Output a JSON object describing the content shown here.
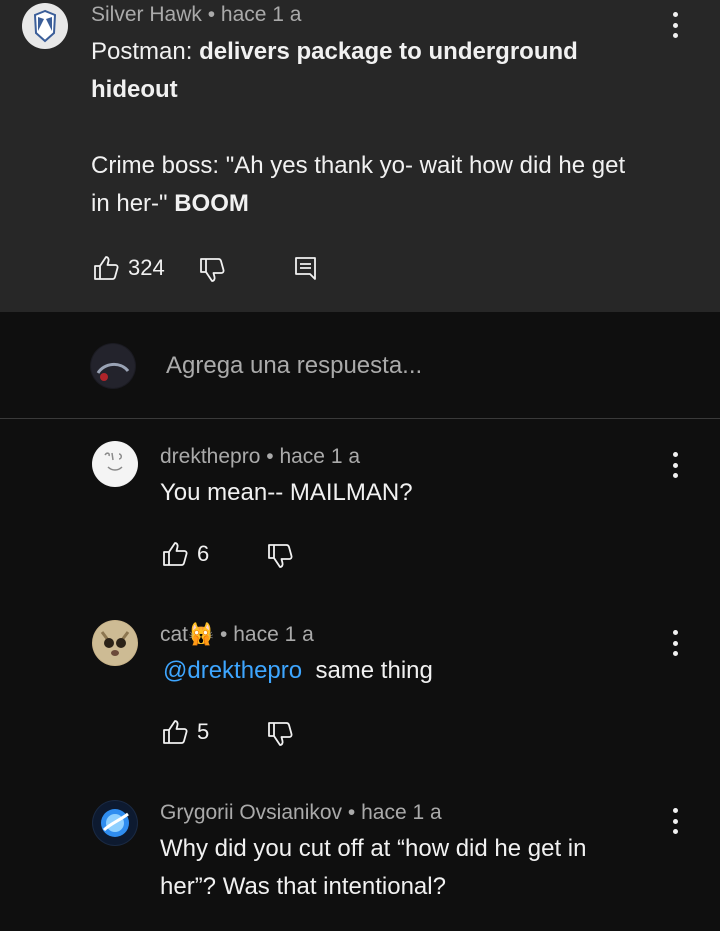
{
  "top_comment": {
    "author": "Silver Hawk",
    "time": "hace 1 a",
    "line1_name": "Postman:",
    "line1_action": "delivers package to underground",
    "line2": "hideout",
    "line3": "Crime boss: \"Ah yes thank yo- wait how did he get",
    "line4_start": "in her-\"",
    "line4_bold": "BOOM",
    "likes": "324"
  },
  "reply_input": {
    "placeholder": "Agrega una respuesta..."
  },
  "replies": [
    {
      "author": "drekthepro",
      "time": "hace 1 a",
      "text": "You mean-- MAILMAN?",
      "likes": "6"
    },
    {
      "author": "cat",
      "author_emoji": "🙀",
      "time": "hace 1 a",
      "mention": "@drekthepro",
      "text": "same thing",
      "likes": "5"
    },
    {
      "author": "Grygorii Ovsianikov",
      "time": "hace 1 a",
      "line1": "Why did you cut off at “how did he get in",
      "line2": "her”? Was that intentional?"
    }
  ],
  "separator": "•",
  "colors": {
    "background": "#0f0f0f",
    "highlight": "#272727",
    "text": "#f1f1f1",
    "meta": "#aaaaaa",
    "link": "#3ea6ff"
  },
  "icons": [
    "like-icon",
    "dislike-icon",
    "reply-icon",
    "more-options-icon"
  ]
}
